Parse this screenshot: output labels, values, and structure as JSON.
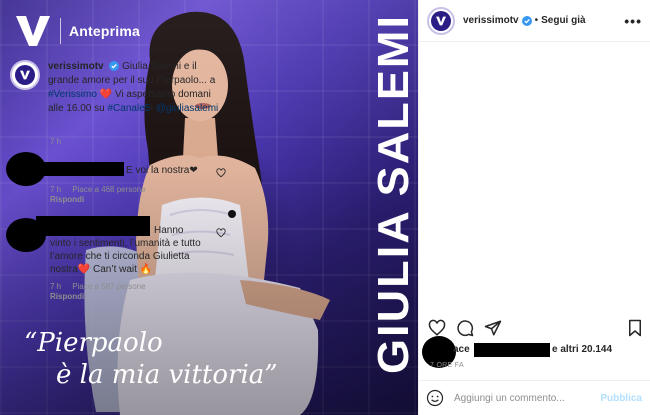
{
  "photo": {
    "brand_text": "Anteprima",
    "quote_line1": "“Pierpaolo",
    "quote_line2": "è la mia vittoria”",
    "vertical_name": "GIULIA SALEMI"
  },
  "header": {
    "username": "verissimotv",
    "separator": "•",
    "follow_label": "Segui già",
    "more_label": "•••"
  },
  "caption": {
    "username": "verissimotv",
    "text_part1": "Giulia Salemi e il grande amore per il suo Pierpaolo... a ",
    "hashtag1": "#Verissimo",
    "text_part2": " Vi aspettiamo domani alle 16.00 su ",
    "hashtag2": "#Canale5",
    "text_part3": "! ",
    "mention": "@giuliasalemi",
    "time": "7 h"
  },
  "comments": [
    {
      "text": "E voi la nostra❤",
      "meta_time": "7 h",
      "meta_likes": "Piace a 468 persone",
      "reply": "Rispondi"
    },
    {
      "text": "Hanno vinto i sentimenti, l’umanità e tutto l’amore che ti circonda Giulietta nostra❤️ Can’t wait 🔥",
      "meta_time": "7 h",
      "meta_likes": "Piace a 587 persone",
      "reply": "Rispondi"
    }
  ],
  "likes": {
    "prefix": "ace",
    "suffix": "e altri 20.144"
  },
  "posted_ago": "7 ORE FA",
  "add_comment": {
    "placeholder": "Aggiungi un commento...",
    "post_label": "Pubblica"
  },
  "colors": {
    "accent_blue": "#0095f6",
    "link_blue": "#00376b",
    "heart_red": "#ed4956",
    "photo_purple": "#4b37b0"
  }
}
